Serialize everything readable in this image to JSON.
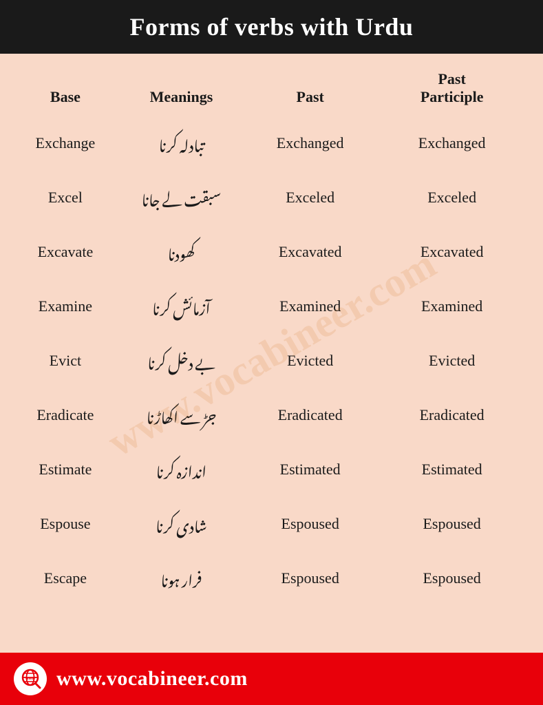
{
  "header": {
    "title": "Forms of verbs with Urdu"
  },
  "table": {
    "columns": {
      "base": "Base",
      "meanings": "Meanings",
      "past": "Past",
      "participle": "Past\nParticiple"
    },
    "rows": [
      {
        "base": "Exchange",
        "meanings": "تبادلہ کرنا",
        "past": "Exchanged",
        "participle": "Exchanged"
      },
      {
        "base": "Excel",
        "meanings": "سبقت لے جانا",
        "past": "Exceled",
        "participle": "Exceled"
      },
      {
        "base": "Excavate",
        "meanings": "کھودنا",
        "past": "Excavated",
        "participle": "Excavated"
      },
      {
        "base": "Examine",
        "meanings": "آزمائش کرنا",
        "past": "Examined",
        "participle": "Examined"
      },
      {
        "base": "Evict",
        "meanings": "بے دخل کرنا",
        "past": "Evicted",
        "participle": "Evicted"
      },
      {
        "base": "Eradicate",
        "meanings": "جڑ سے اکھاڑنا",
        "past": "Eradicated",
        "participle": "Eradicated"
      },
      {
        "base": "Estimate",
        "meanings": "اندازہ کرنا",
        "past": "Estimated",
        "participle": "Estimated"
      },
      {
        "base": "Espouse",
        "meanings": "شادی کرنا",
        "past": "Espoused",
        "participle": "Espoused"
      },
      {
        "base": "Escape",
        "meanings": "فرار ہونا",
        "past": "Espoused",
        "participle": "Espoused"
      }
    ]
  },
  "footer": {
    "url": "www.vocabineer.com",
    "icon_label": "www-icon"
  }
}
